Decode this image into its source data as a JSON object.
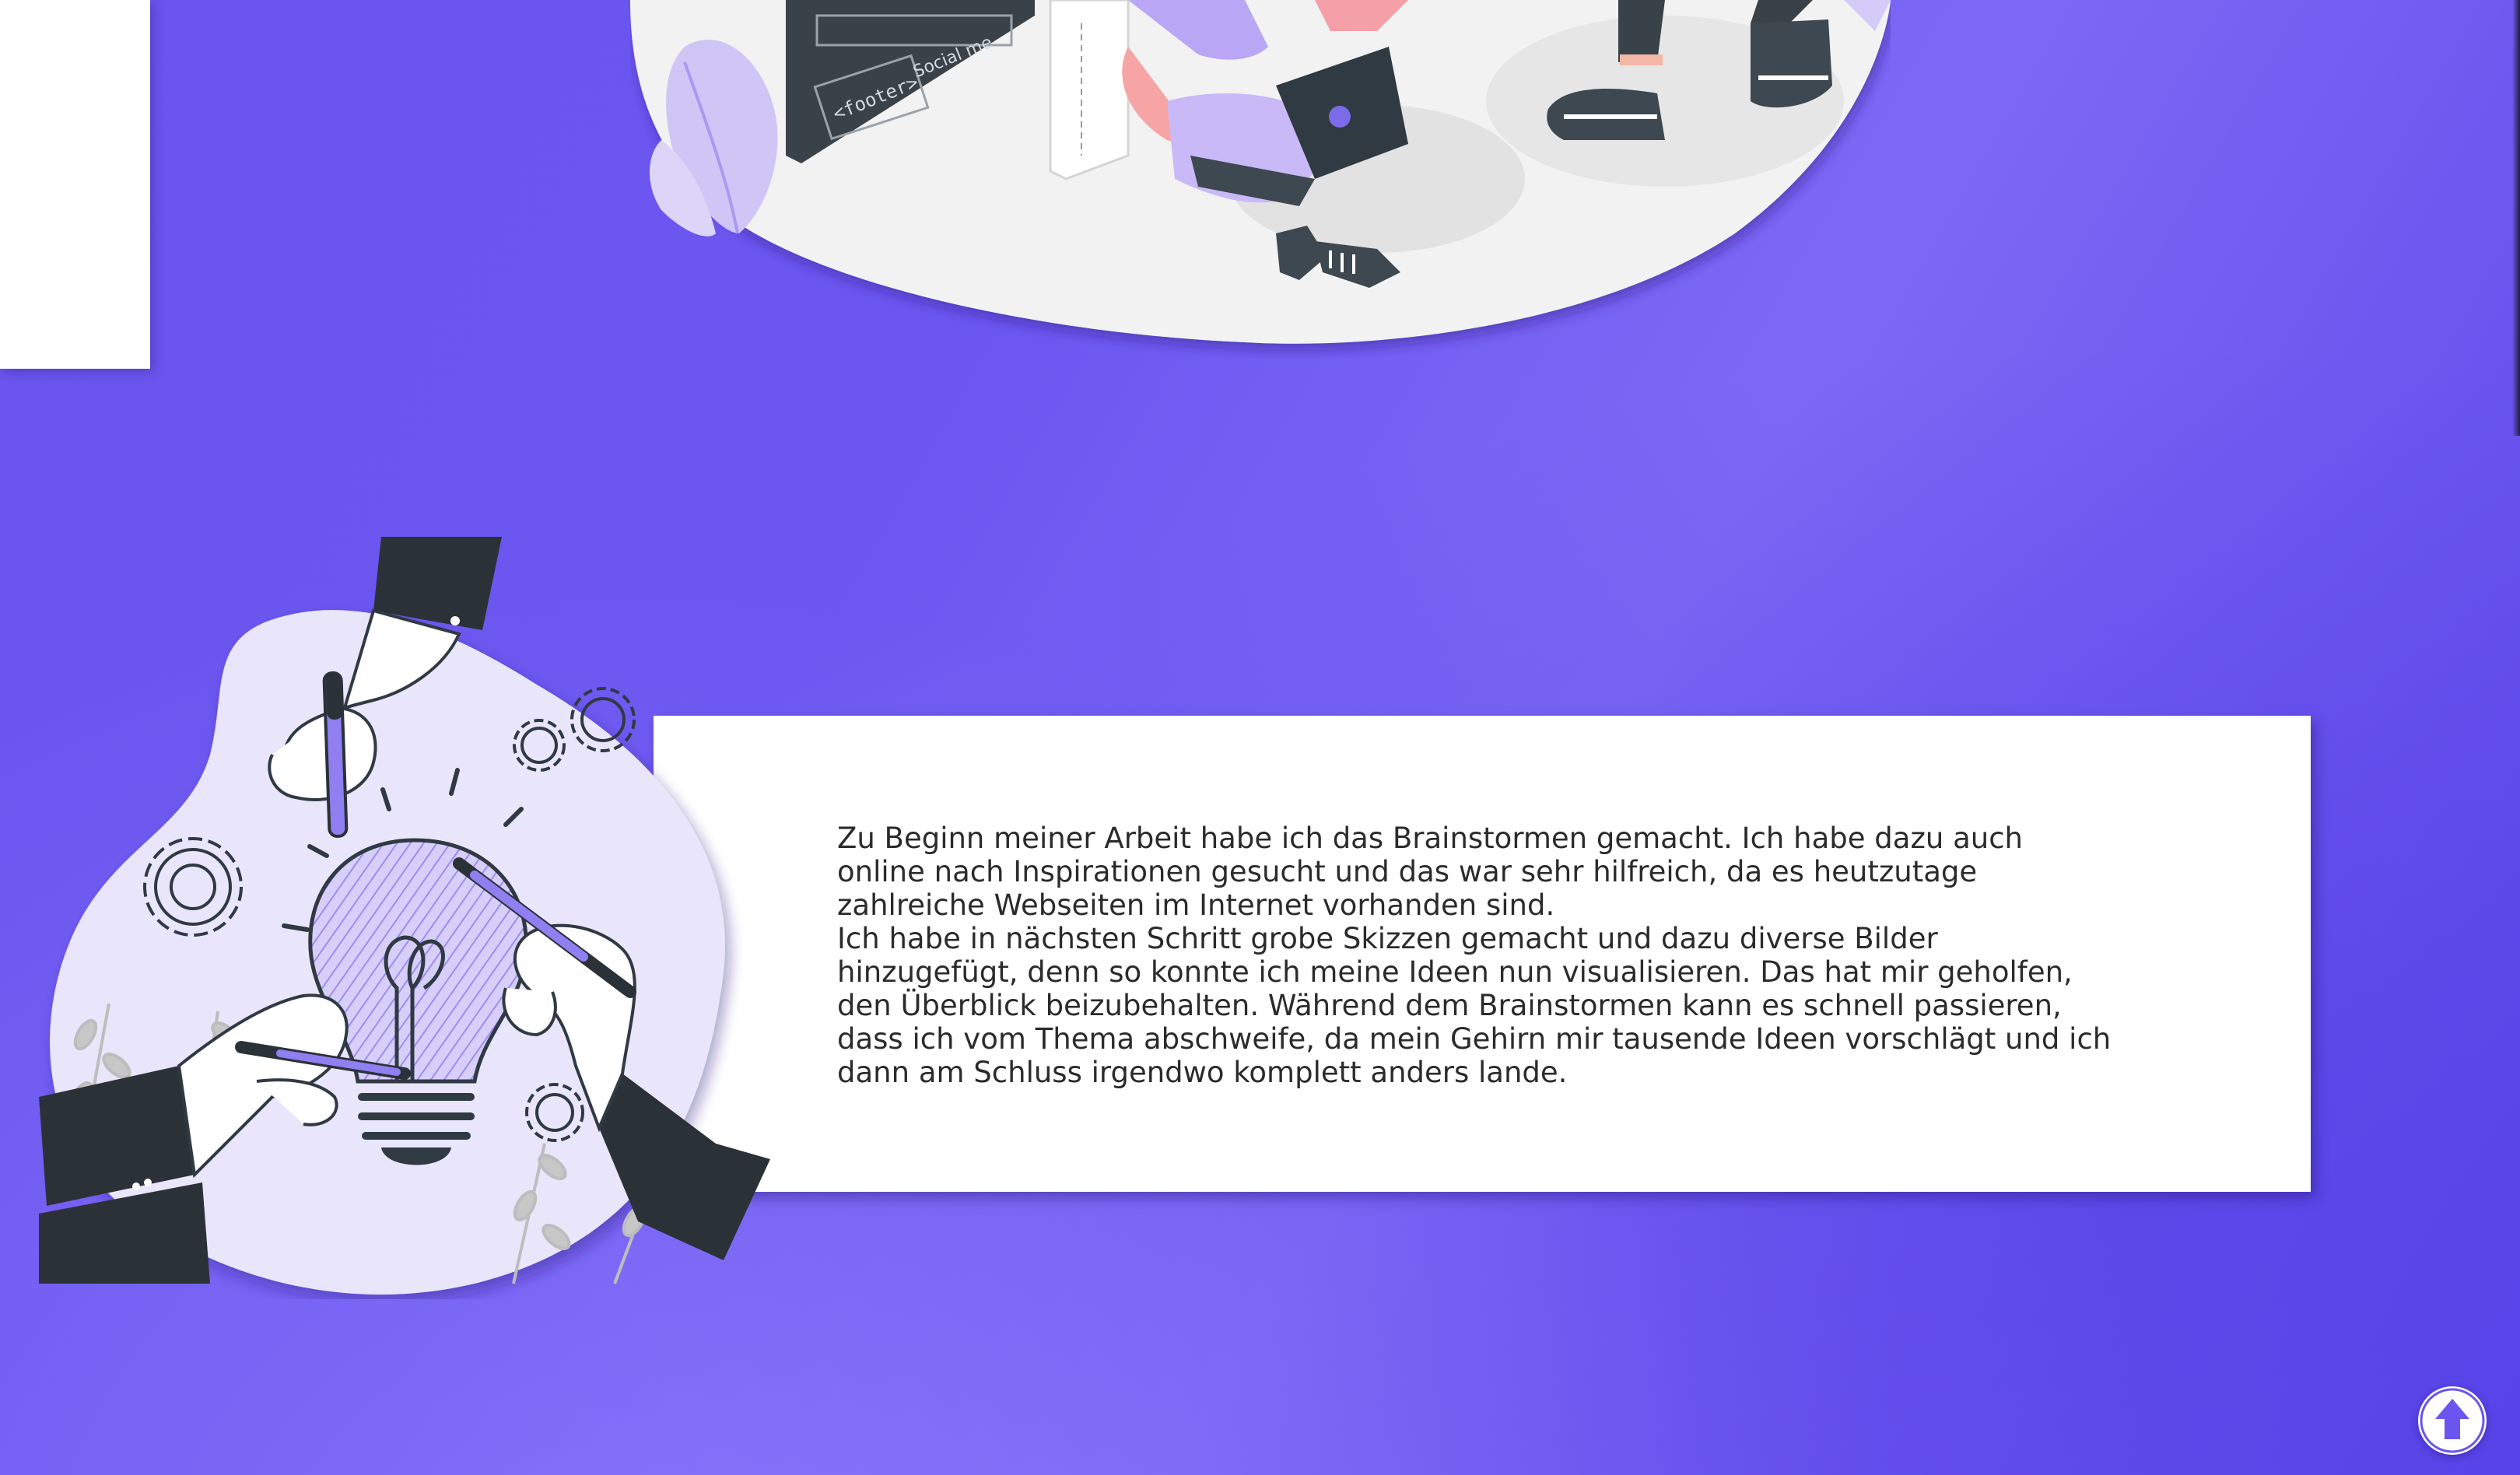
{
  "content": {
    "paragraph_1": "Zu Beginn meiner Arbeit habe ich das Brainstormen gemacht. Ich habe dazu auch online nach Inspirationen gesucht und das war sehr hilfreich, da es heutzutage zahlreiche Webseiten im Internet vorhanden sind.",
    "paragraph_2": "Ich habe in nächsten Schritt grobe Skizzen gemacht und dazu diverse Bilder hinzugefügt, denn so konnte ich meine Ideen nun visualisieren. Das hat mir geholfen, den Überblick beizubehalten. Während dem Brainstormen kann es schnell passieren, dass ich vom Thema abschweife, da mein Gehirn mir tausende Ideen vorschlägt und ich dann am Schluss irgendwo komplett anders lande."
  },
  "illustration_top": {
    "footer_tag": "<footer>",
    "social_tag": "Social me"
  },
  "scroll_top": {
    "icon": "arrow-up-icon"
  },
  "colors": {
    "background": "#6a55ee",
    "accent": "#6a55ee",
    "card": "#ffffff",
    "text": "#2b2b2b",
    "lilac": "#d8d0f7",
    "dark": "#2a3238"
  }
}
